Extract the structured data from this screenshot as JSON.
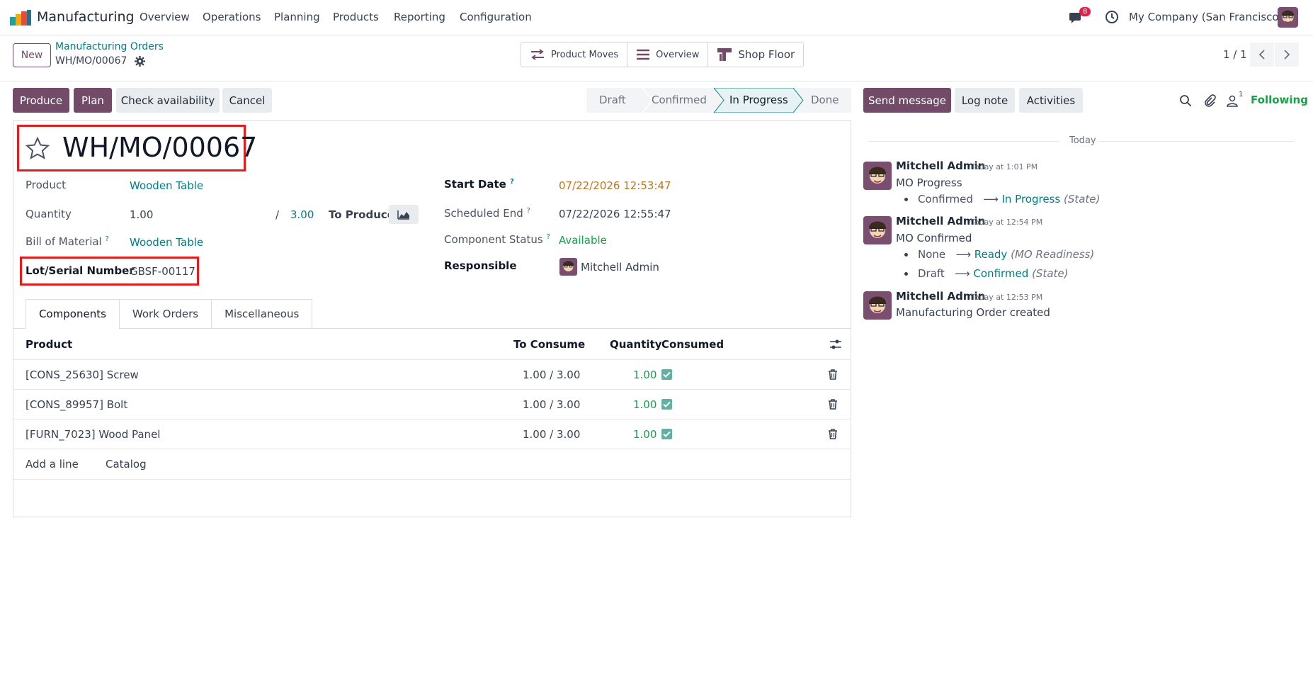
{
  "navbar": {
    "app_name": "Manufacturing",
    "menu": [
      "Overview",
      "Operations",
      "Planning",
      "Products",
      "Reporting",
      "Configuration"
    ],
    "chat_badge": "8",
    "company": "My Company (San Francisco)"
  },
  "control": {
    "new_label": "New",
    "breadcrumb_parent": "Manufacturing Orders",
    "breadcrumb_current": "WH/MO/00067",
    "smart_buttons": [
      "Product Moves",
      "Overview",
      "Shop Floor"
    ],
    "pager": "1 / 1"
  },
  "actions": {
    "produce": "Produce",
    "plan": "Plan",
    "check_availability": "Check availability",
    "cancel": "Cancel"
  },
  "statusbar": {
    "stages": [
      "Draft",
      "Confirmed",
      "In Progress",
      "Done"
    ],
    "active": "In Progress"
  },
  "form": {
    "title": "WH/MO/00067",
    "product_label": "Product",
    "product_value": "Wooden Table",
    "quantity_label": "Quantity",
    "quantity_value": "1.00",
    "quantity_slash": "/",
    "quantity_total": "3.00",
    "to_produce_label": "To Produce",
    "bom_label": "Bill of Material",
    "bom_value": "Wooden Table",
    "lot_label": "Lot/Serial Number",
    "lot_value": "GBSF-00117",
    "start_date_label": "Start Date",
    "start_date_value": "07/22/2026 12:53:47",
    "scheduled_end_label": "Scheduled End",
    "scheduled_end_value": "07/22/2026 12:55:47",
    "component_status_label": "Component Status",
    "component_status_value": "Available",
    "responsible_label": "Responsible",
    "responsible_value": "Mitchell Admin",
    "help_mark": "?"
  },
  "tabs": [
    "Components",
    "Work Orders",
    "Miscellaneous"
  ],
  "table": {
    "headers": {
      "product": "Product",
      "to_consume": "To Consume",
      "quantity": "Quantity",
      "consumed": "Consumed"
    },
    "rows": [
      {
        "product": "[CONS_25630] Screw",
        "to_consume": "1.00 / 3.00",
        "quantity": "1.00",
        "consumed": true
      },
      {
        "product": "[CONS_89957] Bolt",
        "to_consume": "1.00 / 3.00",
        "quantity": "1.00",
        "consumed": true
      },
      {
        "product": "[FURN_7023] Wood Panel",
        "to_consume": "1.00 / 3.00",
        "quantity": "1.00",
        "consumed": true
      }
    ],
    "add_line": "Add a line",
    "catalog": "Catalog"
  },
  "chatter": {
    "send_message": "Send message",
    "log_note": "Log note",
    "activities": "Activities",
    "followers_count": "1",
    "following": "Following",
    "day_label": "Today",
    "messages": [
      {
        "author": "Mitchell Admin",
        "time": "Today at 1:01 PM",
        "body": "MO Progress",
        "tracking": [
          {
            "old": "Confirmed",
            "new": "In Progress",
            "field": "(State)"
          }
        ]
      },
      {
        "author": "Mitchell Admin",
        "time": "Today at 12:54 PM",
        "body": "MO Confirmed",
        "tracking": [
          {
            "old": "None",
            "new": "Ready",
            "field": "(MO Readiness)"
          },
          {
            "old": "Draft",
            "new": "Confirmed",
            "field": "(State)"
          }
        ]
      },
      {
        "author": "Mitchell Admin",
        "time": "Today at 12:53 PM",
        "body": "Manufacturing Order created",
        "tracking": []
      }
    ]
  }
}
